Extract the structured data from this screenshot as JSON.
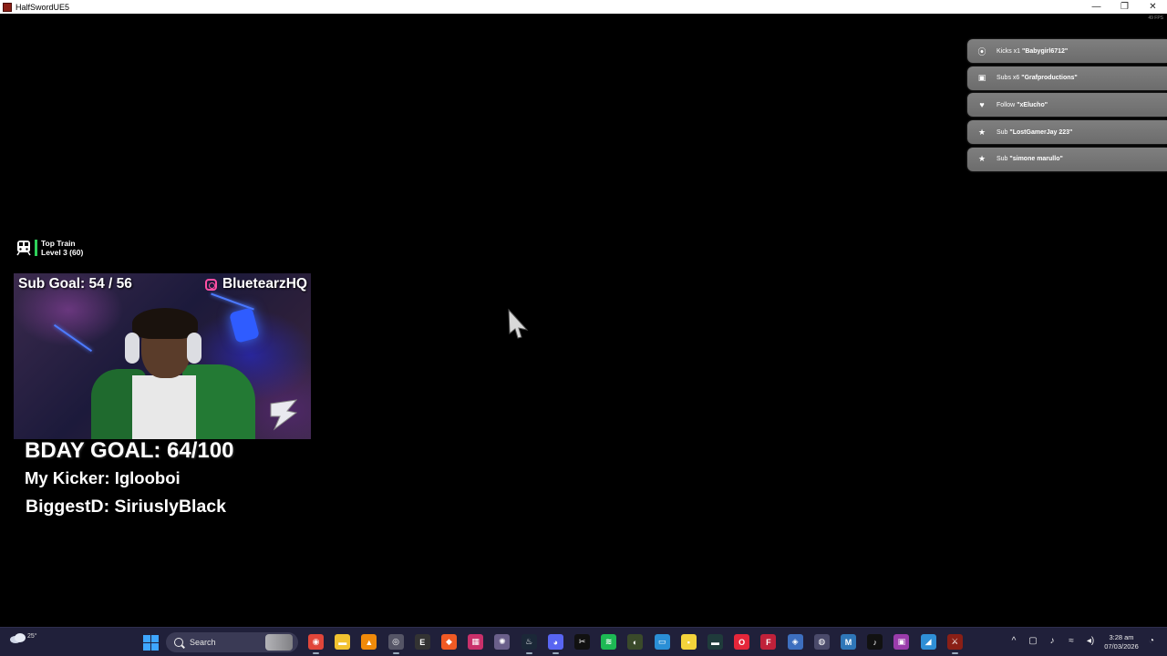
{
  "window": {
    "title": "HalfSwordUE5",
    "minimize": "—",
    "maximize": "❐",
    "close": "✕",
    "fps": "49 FPS"
  },
  "events": [
    {
      "icon": "kick-icon",
      "glyph": "⦿",
      "action": "Kicks x1",
      "user": "\"Babygirl6712\""
    },
    {
      "icon": "gift-icon",
      "glyph": "▣",
      "action": "Subs x6",
      "user": "\"Grafproductions\""
    },
    {
      "icon": "heart-icon",
      "glyph": "♥",
      "action": "Follow",
      "user": "\"xElucho\""
    },
    {
      "icon": "star-icon",
      "glyph": "★",
      "action": "Sub",
      "user": "\"LostGamerJay 223\""
    },
    {
      "icon": "star-icon",
      "glyph": "★",
      "action": "Sub",
      "user": "\"simone marullo\""
    }
  ],
  "train": {
    "title": "Top Train",
    "level": "Level 3  (60)",
    "accent": "#2ed15a"
  },
  "cam": {
    "sub_goal": "Sub Goal:  54 / 56",
    "handle": "BluetearzHQ"
  },
  "goals": {
    "bday": "BDAY GOAL: 64/100",
    "kicker": "My Kicker: Iglooboi",
    "biggest": "BiggestD: SiriuslyBlack"
  },
  "taskbar": {
    "temperature": "25°",
    "search_label": "Search",
    "apps": [
      {
        "name": "chrome-icon",
        "glyph": "◉",
        "color": "#e0463a",
        "active": true
      },
      {
        "name": "folder-icon",
        "glyph": "▬",
        "color": "#f2c230",
        "active": false
      },
      {
        "name": "vlc-icon",
        "glyph": "▲",
        "color": "#f08a0a",
        "active": false
      },
      {
        "name": "obs-icon",
        "glyph": "◎",
        "color": "#555566",
        "active": true
      },
      {
        "name": "epic-games-icon",
        "glyph": "E",
        "color": "#333",
        "active": false
      },
      {
        "name": "brave-icon",
        "glyph": "◆",
        "color": "#f05a24",
        "active": false
      },
      {
        "name": "app-store-icon",
        "glyph": "▦",
        "color": "#c9306a",
        "active": false
      },
      {
        "name": "davinci-icon",
        "glyph": "✺",
        "color": "#6a5f8a",
        "active": false
      },
      {
        "name": "steam-icon",
        "glyph": "♨",
        "color": "#1b2838",
        "active": true
      },
      {
        "name": "discord-icon",
        "glyph": "◕",
        "color": "#5865f2",
        "active": true
      },
      {
        "name": "capcut-icon",
        "glyph": "✂",
        "color": "#111",
        "active": false
      },
      {
        "name": "spotify-icon",
        "glyph": "≋",
        "color": "#1db954",
        "active": false
      },
      {
        "name": "gauge-icon",
        "glyph": "◐",
        "color": "#3a4a2a",
        "active": false
      },
      {
        "name": "photos-icon",
        "glyph": "▭",
        "color": "#2a8fd6",
        "active": false
      },
      {
        "name": "sticky-notes-icon",
        "glyph": "▪",
        "color": "#f4d33b",
        "active": false
      },
      {
        "name": "terminal-icon",
        "glyph": "▬",
        "color": "#1f3b3b",
        "active": false
      },
      {
        "name": "opera-icon",
        "glyph": "O",
        "color": "#e5263a",
        "active": false
      },
      {
        "name": "f-app-icon",
        "glyph": "F",
        "color": "#c0213a",
        "active": false
      },
      {
        "name": "diamond-app-icon",
        "glyph": "◈",
        "color": "#3d6fbf",
        "active": false
      },
      {
        "name": "disc-icon",
        "glyph": "◍",
        "color": "#4a4a6a",
        "active": false
      },
      {
        "name": "mkv-icon",
        "glyph": "M",
        "color": "#2f77b8",
        "active": false
      },
      {
        "name": "tiktok-icon",
        "glyph": "♪",
        "color": "#111",
        "active": false
      },
      {
        "name": "game-app-icon",
        "glyph": "▣",
        "color": "#9a3cab",
        "active": false
      },
      {
        "name": "editor-icon",
        "glyph": "◢",
        "color": "#2f8fd6",
        "active": false
      },
      {
        "name": "halfsword-icon",
        "glyph": "⚔",
        "color": "#8a1f16",
        "active": true
      }
    ],
    "tray_chevron": "^",
    "tray_icons": [
      "▢",
      "♪",
      "≈",
      "◂)"
    ],
    "time": "3:28 am",
    "date": "07/03/2026",
    "bell": "◔"
  }
}
